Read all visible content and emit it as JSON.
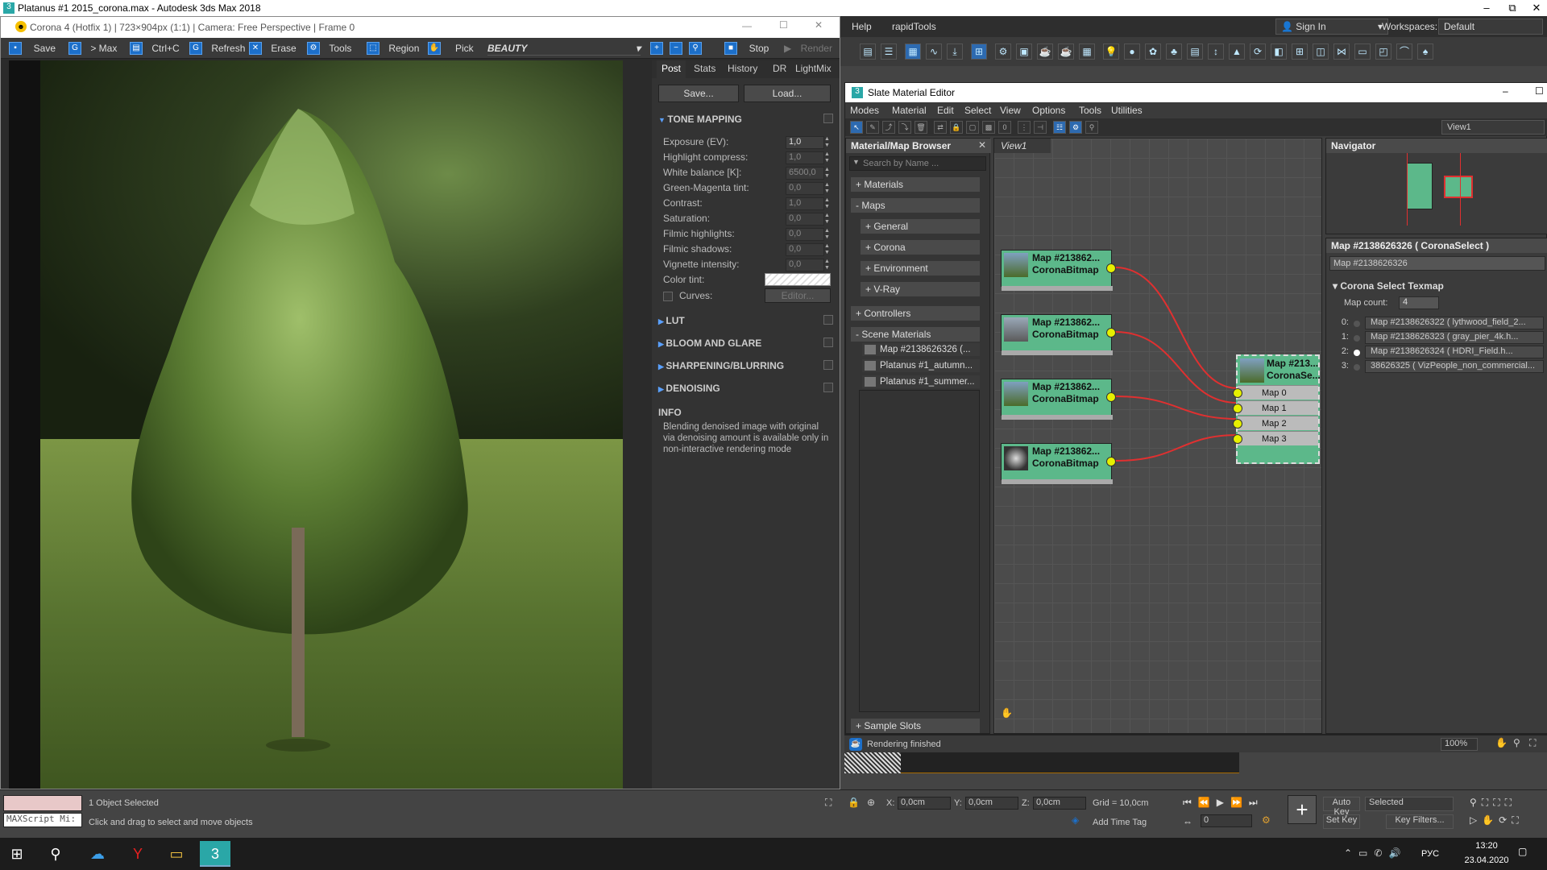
{
  "main_window": {
    "title": "Platanus #1 2015_corona.max - Autodesk 3ds Max 2018",
    "window_controls": [
      "–",
      "⧉",
      "✕"
    ]
  },
  "frame_buffer": {
    "title": "Corona 4 (Hotfix 1) | 723×904px (1:1) | Camera: Free Perspective | Frame 0",
    "toolbar": {
      "save": "Save",
      "to_max": "> Max",
      "copy": "Ctrl+C",
      "refresh": "Refresh",
      "erase": "Erase",
      "tools": "Tools",
      "region": "Region",
      "pick": "Pick",
      "channel": "BEAUTY",
      "stop": "Stop",
      "render": "Render"
    },
    "panel_tabs": [
      "Post",
      "Stats",
      "History",
      "DR",
      "LightMix"
    ],
    "save_btn": "Save...",
    "load_btn": "Load...",
    "tone_mapping": {
      "header": "TONE MAPPING",
      "rows": [
        {
          "label": "Exposure (EV):",
          "value": "1,0"
        },
        {
          "label": "Highlight compress:",
          "value": "1,0"
        },
        {
          "label": "White balance [K]:",
          "value": "6500,0"
        },
        {
          "label": "Green-Magenta tint:",
          "value": "0,0"
        },
        {
          "label": "Contrast:",
          "value": "1,0"
        },
        {
          "label": "Saturation:",
          "value": "0,0"
        },
        {
          "label": "Filmic highlights:",
          "value": "0,0"
        },
        {
          "label": "Filmic shadows:",
          "value": "0,0"
        },
        {
          "label": "Vignette intensity:",
          "value": "0,0"
        }
      ],
      "color_tint": "Color tint:",
      "curves": "Curves:",
      "editor": "Editor..."
    },
    "sections": [
      "LUT",
      "BLOOM AND GLARE",
      "SHARPENING/BLURRING",
      "DENOISING"
    ],
    "info_header": "INFO",
    "info_text": "Blending denoised image with original via denoising amount is available only in non-interactive rendering mode"
  },
  "max_menu": {
    "help": "Help",
    "rapidtools": "rapidTools",
    "sign_in": "Sign In",
    "workspaces_label": "Workspaces:",
    "workspace": "Default"
  },
  "slate": {
    "title": "Slate Material Editor",
    "menu": [
      "Modes",
      "Material",
      "Edit",
      "Select",
      "View",
      "Options",
      "Tools",
      "Utilities"
    ],
    "view_tab_right": "View1",
    "browser": {
      "header": "Material/Map Browser",
      "search_placeholder": "Search by Name ...",
      "materials": "+ Materials",
      "maps": "- Maps",
      "map_groups": [
        "+ General",
        "+ Corona",
        "+ Environment",
        "+ V-Ray"
      ],
      "controllers": "+ Controllers",
      "scene_materials": "- Scene Materials",
      "scene_items": [
        "Map #2138626326  (...",
        "Platanus #1_autumn...",
        "Platanus #1_summer..."
      ],
      "sample_slots": "+ Sample Slots"
    },
    "view_name": "View1",
    "nodes": [
      {
        "name": "Map #213862...",
        "type": "CoronaBitmap"
      },
      {
        "name": "Map #213862...",
        "type": "CoronaBitmap"
      },
      {
        "name": "Map #213862...",
        "type": "CoronaBitmap"
      },
      {
        "name": "Map #213862...",
        "type": "CoronaBitmap"
      }
    ],
    "select_node": {
      "name": "Map #213...",
      "type": "CoronaSe..."
    },
    "select_slots": [
      "Map 0",
      "Map 1",
      "Map 2 (selected)",
      "Map 3"
    ],
    "navigator": "Navigator",
    "param_title": "Map #2138626326  ( CoronaSelect )",
    "param_name": "Map #2138626326",
    "rollout": "Corona Select Texmap",
    "map_count_label": "Map count:",
    "map_count": "4",
    "map_list": [
      {
        "idx": "0:",
        "text": "Map #2138626322 ( lythwood_field_2..."
      },
      {
        "idx": "1:",
        "text": "Map #2138626323 ( gray_pier_4k.h..."
      },
      {
        "idx": "2:",
        "text": "Map #2138626324 ( HDRI_Field.h..."
      },
      {
        "idx": "3:",
        "text": "38626325 ( VizPeople_non_commercial..."
      }
    ],
    "status": "Rendering finished",
    "zoom": "100%"
  },
  "status_bar": {
    "maxscript": "MAXScript Mi:",
    "selected": "1 Object Selected",
    "hint": "Click and drag to select and move objects",
    "x_label": "X:",
    "x": "0,0cm",
    "y_label": "Y:",
    "y": "0,0cm",
    "z_label": "Z:",
    "z": "0,0cm",
    "grid": "Grid = 10,0cm",
    "add_time_tag": "Add Time Tag",
    "frame": "0",
    "auto_key": "Auto Key",
    "set_key": "Set Key",
    "selected_dd": "Selected",
    "key_filters": "Key Filters..."
  },
  "taskbar": {
    "lang": "РУС",
    "time": "13:20",
    "date": "23.04.2020"
  },
  "colors": {
    "node_green": "#5cb88a",
    "wire_red": "#e03030",
    "socket_yellow": "#e6f000",
    "accent_blue": "#1c6fc9"
  }
}
